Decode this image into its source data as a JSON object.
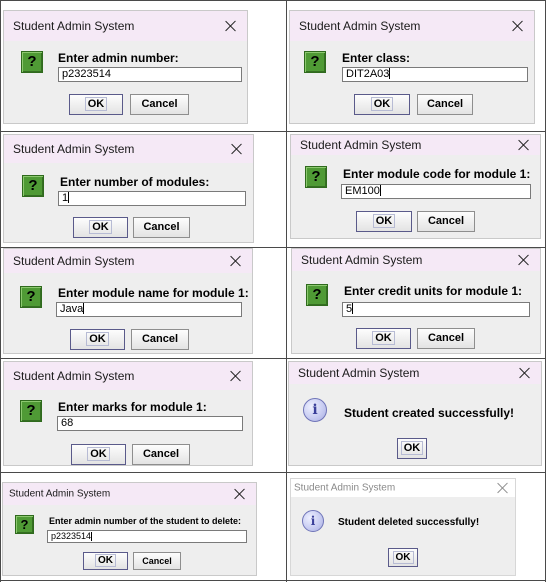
{
  "dialogs": [
    {
      "title": "Student Admin System",
      "prompt": "Enter admin number:",
      "value": "p2323514",
      "ok": "OK",
      "cancel": "Cancel"
    },
    {
      "title": "Student Admin System",
      "prompt": "Enter class:",
      "value": "DIT2A03",
      "ok": "OK",
      "cancel": "Cancel"
    },
    {
      "title": "Student Admin System",
      "prompt": "Enter number of modules:",
      "value": "1",
      "ok": "OK",
      "cancel": "Cancel"
    },
    {
      "title": "Student Admin System",
      "prompt": "Enter module code for module 1:",
      "value": "EM100",
      "ok": "OK",
      "cancel": "Cancel"
    },
    {
      "title": "Student Admin System",
      "prompt": "Enter module name for module 1:",
      "value": "Java",
      "ok": "OK",
      "cancel": "Cancel"
    },
    {
      "title": "Student Admin System",
      "prompt": "Enter credit units for module 1:",
      "value": "5",
      "ok": "OK",
      "cancel": "Cancel"
    },
    {
      "title": "Student Admin System",
      "prompt": "Enter marks for module 1:",
      "value": "68",
      "ok": "OK",
      "cancel": "Cancel"
    },
    {
      "title": "Student Admin System",
      "message": "Student created successfully!",
      "ok": "OK"
    },
    {
      "title": "Student Admin System",
      "prompt": "Enter admin number of the student to delete:",
      "value": "p2323514",
      "ok": "OK",
      "cancel": "Cancel"
    },
    {
      "title": "Student Admin System",
      "message": "Student deleted successfully!",
      "ok": "OK"
    }
  ],
  "icons": {
    "question": "?",
    "info": "i"
  },
  "colors": {
    "titlebar": "#f5e9f6",
    "dialog_bg": "#eeeeee",
    "question_icon": "#4f9a35",
    "info_icon": "#c9cdf2"
  }
}
